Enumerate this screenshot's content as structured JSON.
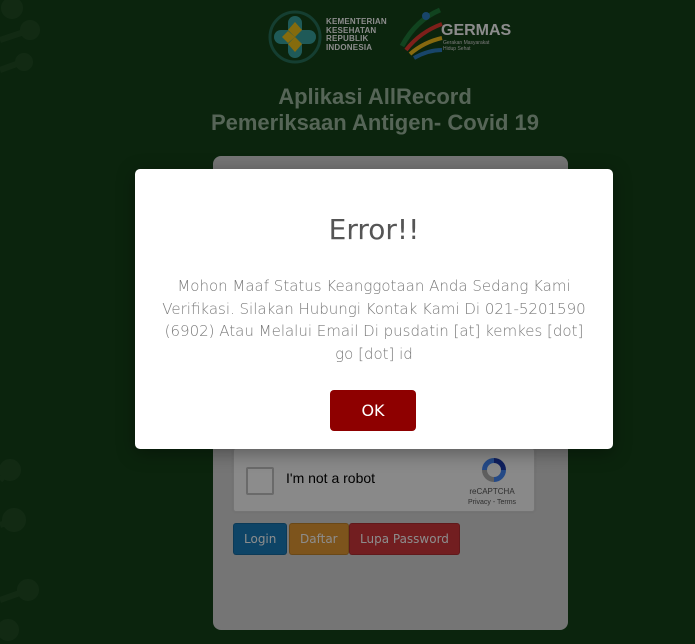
{
  "colors": {
    "background": "#1d5c22",
    "panel": "#d6d6d6",
    "modal": "#ffffff",
    "ok_button": "#8e0000",
    "login_button": "#1a7dba",
    "daftar_button": "#e49a33",
    "lupa_button": "#d0373b"
  },
  "header": {
    "kemkes_lines": [
      "KEMENTERIAN",
      "KESEHATAN",
      "REPUBLIK",
      "INDONESIA"
    ],
    "germas_title": "GERMAS",
    "germas_subtitle": "Gerakan Masyarakat Hidup Sehat",
    "title_line1": "Aplikasi AllRecord",
    "title_line2": "Pemeriksaan Antigen- Covid 19"
  },
  "login": {
    "recaptcha_label": "I'm not a robot",
    "recaptcha_brand": "reCAPTCHA",
    "recaptcha_terms": "Privacy - Terms",
    "login_label": "Login",
    "daftar_label": "Daftar",
    "lupa_label": "Lupa Password"
  },
  "modal": {
    "title": "Error!!",
    "message": "Mohon Maaf Status Keanggotaan Anda Sedang Kami Verifikasi. Silakan Hubungi Kontak Kami Di 021-5201590 (6902) Atau Melalui Email Di pusdatin [at] kemkes [dot] go [dot] id",
    "ok_label": "OK"
  },
  "icons": [
    "kemkes-logo",
    "germas-logo",
    "virus-background",
    "recaptcha-logo"
  ]
}
